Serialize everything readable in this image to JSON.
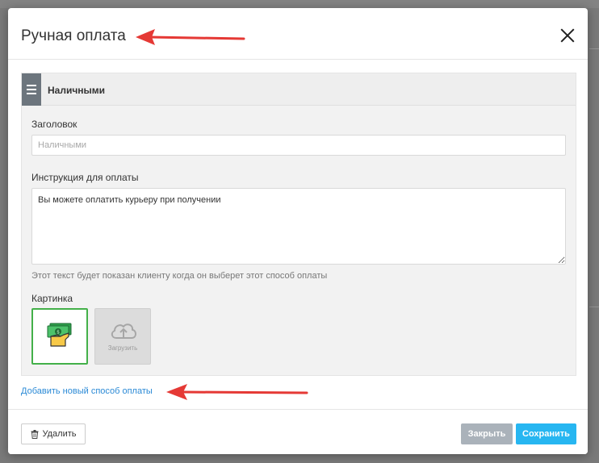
{
  "modal": {
    "title": "Ручная оплата"
  },
  "method": {
    "name": "Наличными",
    "title_label": "Заголовок",
    "title_placeholder": "Наличными",
    "instruction_label": "Инструкция для оплаты",
    "instruction_value": "Вы можете оплатить курьеру при получении",
    "instruction_hint": "Этот текст будет показан клиенту когда он выберет этот способ оплаты",
    "image_label": "Картинка",
    "upload_label": "Загрузить"
  },
  "add_method_link": "Добавить новый способ оплаты",
  "footer": {
    "delete_label": "Удалить",
    "close_label": "Закрыть",
    "save_label": "Сохранить"
  },
  "colors": {
    "accent": "#27b6f1",
    "link": "#2b8ad6",
    "selected_border": "#43b049",
    "annotation_arrow": "#e53935"
  },
  "icons": {
    "close": "close-icon",
    "drag": "hamburger-icon",
    "payment": "cash-hand-icon",
    "upload": "cloud-upload-icon",
    "delete": "trash-icon"
  }
}
